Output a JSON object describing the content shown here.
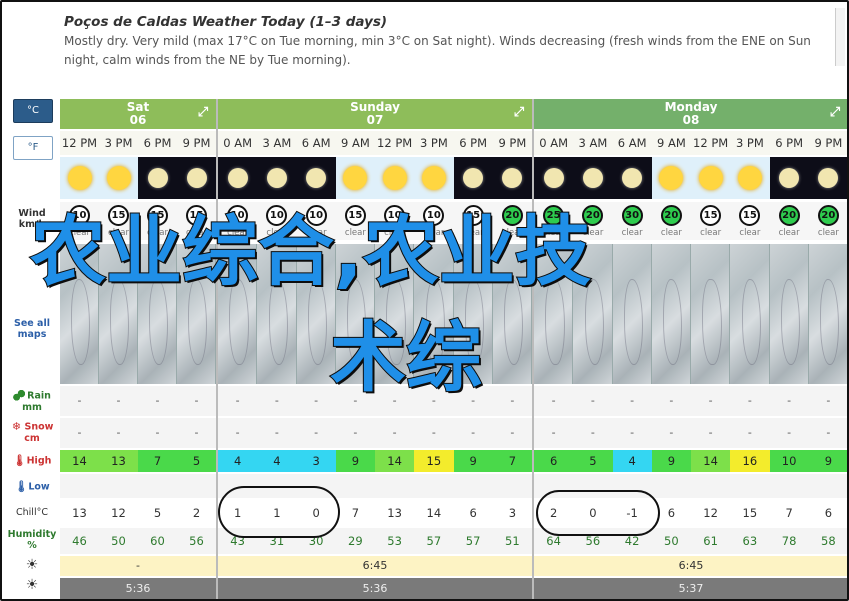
{
  "header": {
    "title": "Poços de Caldas Weather Today (1–3 days)",
    "summary": "Mostly dry. Very mild (max 17°C on Tue morning, min 3°C on Sat night). Winds decreasing (fresh winds from the ENE on Sun night, calm winds from the NE by Tue morning)."
  },
  "units": {
    "celsius": "°C",
    "fahrenheit": "°F"
  },
  "row_labels": {
    "wind": "Wind km/h",
    "maps": "See all maps",
    "rain": "Rain mm",
    "snow": "Snow cm",
    "high": "High",
    "low": "Low",
    "chill": "Chill°C",
    "humidity": "Humidity %"
  },
  "days": [
    {
      "name": "Sat",
      "date": "06",
      "times": [
        "12 PM",
        "3 PM",
        "6 PM",
        "9 PM"
      ],
      "sky": [
        "sun",
        "sun",
        "moon",
        "moon"
      ],
      "wind": [
        "10",
        "15",
        "15",
        "15"
      ],
      "wind_text": [
        "clear",
        "clear",
        "clear",
        "clear"
      ],
      "rain": [
        "-",
        "-",
        "-",
        "-"
      ],
      "snow": [
        "-",
        "-",
        "-",
        "-"
      ],
      "high": [
        "14",
        "13",
        "7",
        "5"
      ],
      "high_colors": [
        "#7de04a",
        "#7de04a",
        "#4ad94a",
        "#4ad94a"
      ],
      "chill": [
        "13",
        "12",
        "5",
        "2"
      ],
      "humidity": [
        "46",
        "50",
        "60",
        "56"
      ],
      "sunrise": "-",
      "sunset": "5:36"
    },
    {
      "name": "Sunday",
      "date": "07",
      "times": [
        "0 AM",
        "3 AM",
        "6 AM",
        "9 AM",
        "12 PM",
        "3 PM",
        "6 PM",
        "9 PM"
      ],
      "sky": [
        "moon",
        "moon",
        "moon",
        "sun",
        "sun",
        "sun",
        "moon",
        "moon"
      ],
      "wind": [
        "10",
        "10",
        "10",
        "15",
        "10",
        "10",
        "15",
        "20"
      ],
      "wind_text": [
        "clear",
        "clear",
        "clear",
        "clear",
        "clear",
        "clear",
        "clear",
        "clear"
      ],
      "rain": [
        "-",
        "-",
        "-",
        "-",
        "-",
        "-",
        "-",
        "-"
      ],
      "snow": [
        "-",
        "-",
        "-",
        "-",
        "-",
        "-",
        "-",
        "-"
      ],
      "high": [
        "4",
        "4",
        "3",
        "9",
        "14",
        "15",
        "9",
        "7"
      ],
      "high_colors": [
        "#34d6f2",
        "#34d6f2",
        "#34d6f2",
        "#4ad94a",
        "#7de04a",
        "#f3ec2c",
        "#4ad94a",
        "#4ad94a"
      ],
      "chill": [
        "1",
        "1",
        "0",
        "7",
        "13",
        "14",
        "6",
        "3"
      ],
      "humidity": [
        "43",
        "31",
        "30",
        "29",
        "53",
        "57",
        "57",
        "51"
      ],
      "sunrise": "6:45",
      "sunset": "5:36"
    },
    {
      "name": "Monday",
      "date": "08",
      "times": [
        "0 AM",
        "3 AM",
        "6 AM",
        "9 AM",
        "12 PM",
        "3 PM",
        "6 PM",
        "9 PM"
      ],
      "sky": [
        "moon",
        "moon",
        "moon",
        "sun",
        "sun",
        "sun",
        "moon",
        "moon"
      ],
      "wind": [
        "25",
        "20",
        "30",
        "20",
        "15",
        "15",
        "20",
        "20"
      ],
      "wind_text": [
        "clear",
        "clear",
        "clear",
        "clear",
        "clear",
        "clear",
        "clear",
        "clear"
      ],
      "rain": [
        "-",
        "-",
        "-",
        "-",
        "-",
        "-",
        "-",
        "-"
      ],
      "snow": [
        "-",
        "-",
        "-",
        "-",
        "-",
        "-",
        "-",
        "-"
      ],
      "high": [
        "6",
        "5",
        "4",
        "9",
        "14",
        "16",
        "10",
        "9"
      ],
      "high_colors": [
        "#4ad94a",
        "#4ad94a",
        "#34d6f2",
        "#4ad94a",
        "#7de04a",
        "#f3ec2c",
        "#4ad94a",
        "#4ad94a"
      ],
      "chill": [
        "2",
        "0",
        "-1",
        "6",
        "12",
        "15",
        "7",
        "6"
      ],
      "humidity": [
        "64",
        "56",
        "42",
        "50",
        "61",
        "63",
        "78",
        "58"
      ],
      "sunrise": "6:45",
      "sunset": "5:37"
    }
  ],
  "overlay": {
    "line1": "农业综合,农业技",
    "line2": "术综"
  }
}
